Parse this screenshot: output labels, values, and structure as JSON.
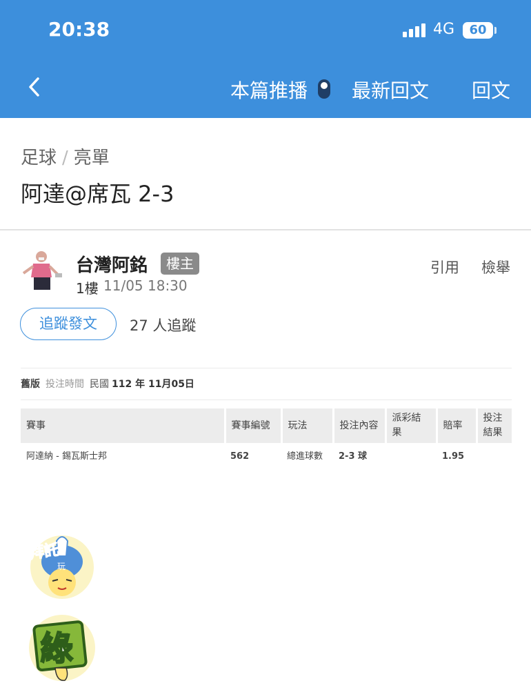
{
  "status_bar": {
    "time": "20:38",
    "network": "4G",
    "battery": "60"
  },
  "nav": {
    "back_icon": "chevron-left-icon",
    "push_label": "本篇推播",
    "latest_label": "最新回文",
    "reply_label": "回文"
  },
  "breadcrumb": {
    "category": "足球",
    "separator": "/",
    "subcategory": "亮單"
  },
  "post": {
    "title": "阿達@席瓦 2-3",
    "author": "台灣阿銘",
    "op_badge": "樓主",
    "floor": "1樓",
    "time": "11/05 18:30",
    "quote_label": "引用",
    "report_label": "檢舉",
    "follow_button": "追蹤發文",
    "follower_count": "27 人追蹤"
  },
  "bet_slip": {
    "meta_version": "舊版",
    "meta_label": "投注時間",
    "meta_era": "民國",
    "meta_date": "112 年 11月05日",
    "headers": [
      "賽事",
      "賽事編號",
      "玩法",
      "投注內容",
      "派彩結果",
      "賠率",
      "投注結果"
    ],
    "rows": [
      {
        "match": "阿達納 - 錫瓦斯士邦",
        "id": "562",
        "play": "總進球數",
        "selection": "2-3 球",
        "payout": "",
        "odds": "1.95",
        "result": ""
      }
    ]
  },
  "stickers": {
    "sticker1_text": "拜託",
    "sticker1_subtext": "玩",
    "sticker2_text": "綠"
  },
  "colors": {
    "brand_blue": "#3d8fdc",
    "badge_gray": "#8a8a8a",
    "toggle_dark": "#1f3e66"
  }
}
